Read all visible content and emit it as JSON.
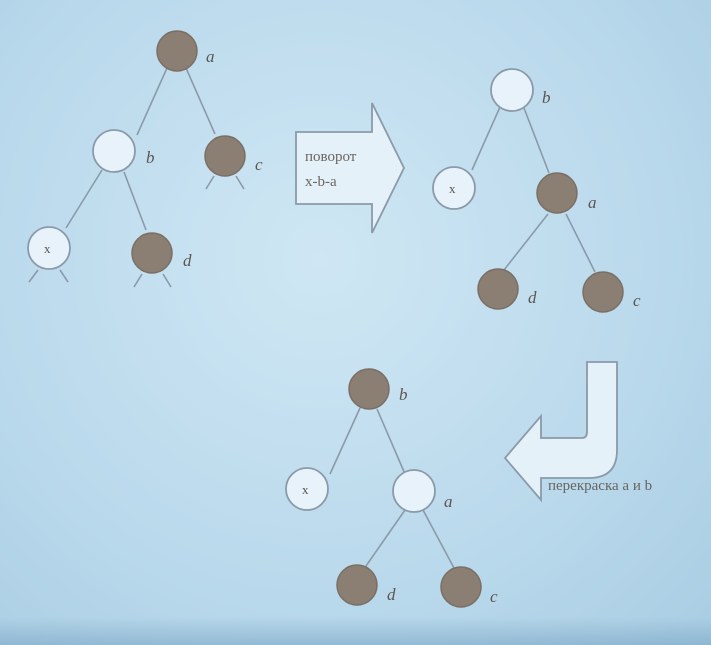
{
  "labels": {
    "a": "a",
    "b": "b",
    "c": "c",
    "d": "d",
    "x": "x"
  },
  "arrows": {
    "rotation_line1": "поворот",
    "rotation_line2": "x-b-a",
    "recolor": "перекраска a и b"
  },
  "colors": {
    "black_node": "#8b7f74",
    "red_node": "#e8f2fa",
    "edge": "#8a9aa8",
    "background": "#bcdcee"
  }
}
